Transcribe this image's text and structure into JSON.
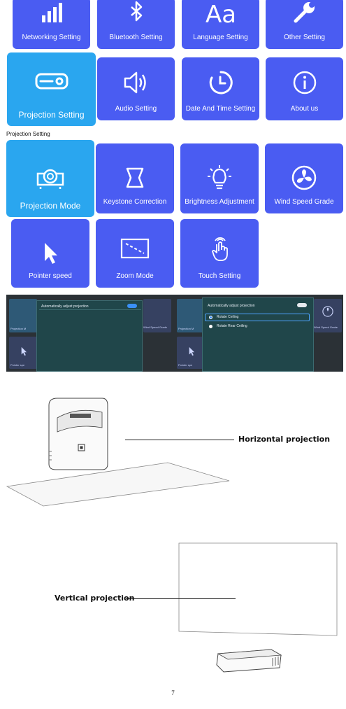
{
  "top_menu": {
    "items": [
      {
        "label": "Networking Setting",
        "icon": "signal-bars-icon"
      },
      {
        "label": "Bluetooth Setting",
        "icon": "bluetooth-icon"
      },
      {
        "label": "Language Setting",
        "icon": "language-aa-icon"
      },
      {
        "label": "Other Setting",
        "icon": "wrench-icon"
      },
      {
        "label": "Projection Setting",
        "icon": "projector-icon",
        "active": true
      },
      {
        "label": "Audio Setting",
        "icon": "speaker-icon"
      },
      {
        "label": "Date And Time Setting",
        "icon": "clock-icon"
      },
      {
        "label": "About us",
        "icon": "info-icon"
      }
    ]
  },
  "section_caption": "Projection Setting",
  "projection_menu": {
    "items": [
      {
        "label": "Projection Mode",
        "icon": "projector-lens-icon",
        "active": true
      },
      {
        "label": "Keystone Correction",
        "icon": "keystone-icon"
      },
      {
        "label": "Brightness Adjustment",
        "icon": "lightbulb-icon"
      },
      {
        "label": "Wind Speed Grade",
        "icon": "fan-icon"
      },
      {
        "label": "Pointer speed",
        "icon": "cursor-arrow-icon"
      },
      {
        "label": "Zoom Mode",
        "icon": "zoom-frame-icon"
      },
      {
        "label": "Touch Setting",
        "icon": "touch-hand-icon"
      }
    ]
  },
  "screenshot_left": {
    "dialog_title": "Automatically adjust projection",
    "bg_labels": [
      "Projection M",
      "Wind Speed Grade",
      "Pointer spe"
    ]
  },
  "screenshot_right": {
    "dialog_title": "Automatically adjust projection",
    "options": [
      "Rotate Ceiling",
      "Rotate Rear Ceiling"
    ],
    "bg_labels": [
      "Projection M",
      "Wind Speed Grade",
      "Pointer spe"
    ]
  },
  "diagrams": {
    "horizontal_label": "Horizontal projection",
    "vertical_label": "Vertical projection"
  },
  "page_number": "7",
  "colors": {
    "tile": "#4a5cf2",
    "tile_active": "#2aa6ef",
    "toggle_on": "#3a8ff5"
  }
}
